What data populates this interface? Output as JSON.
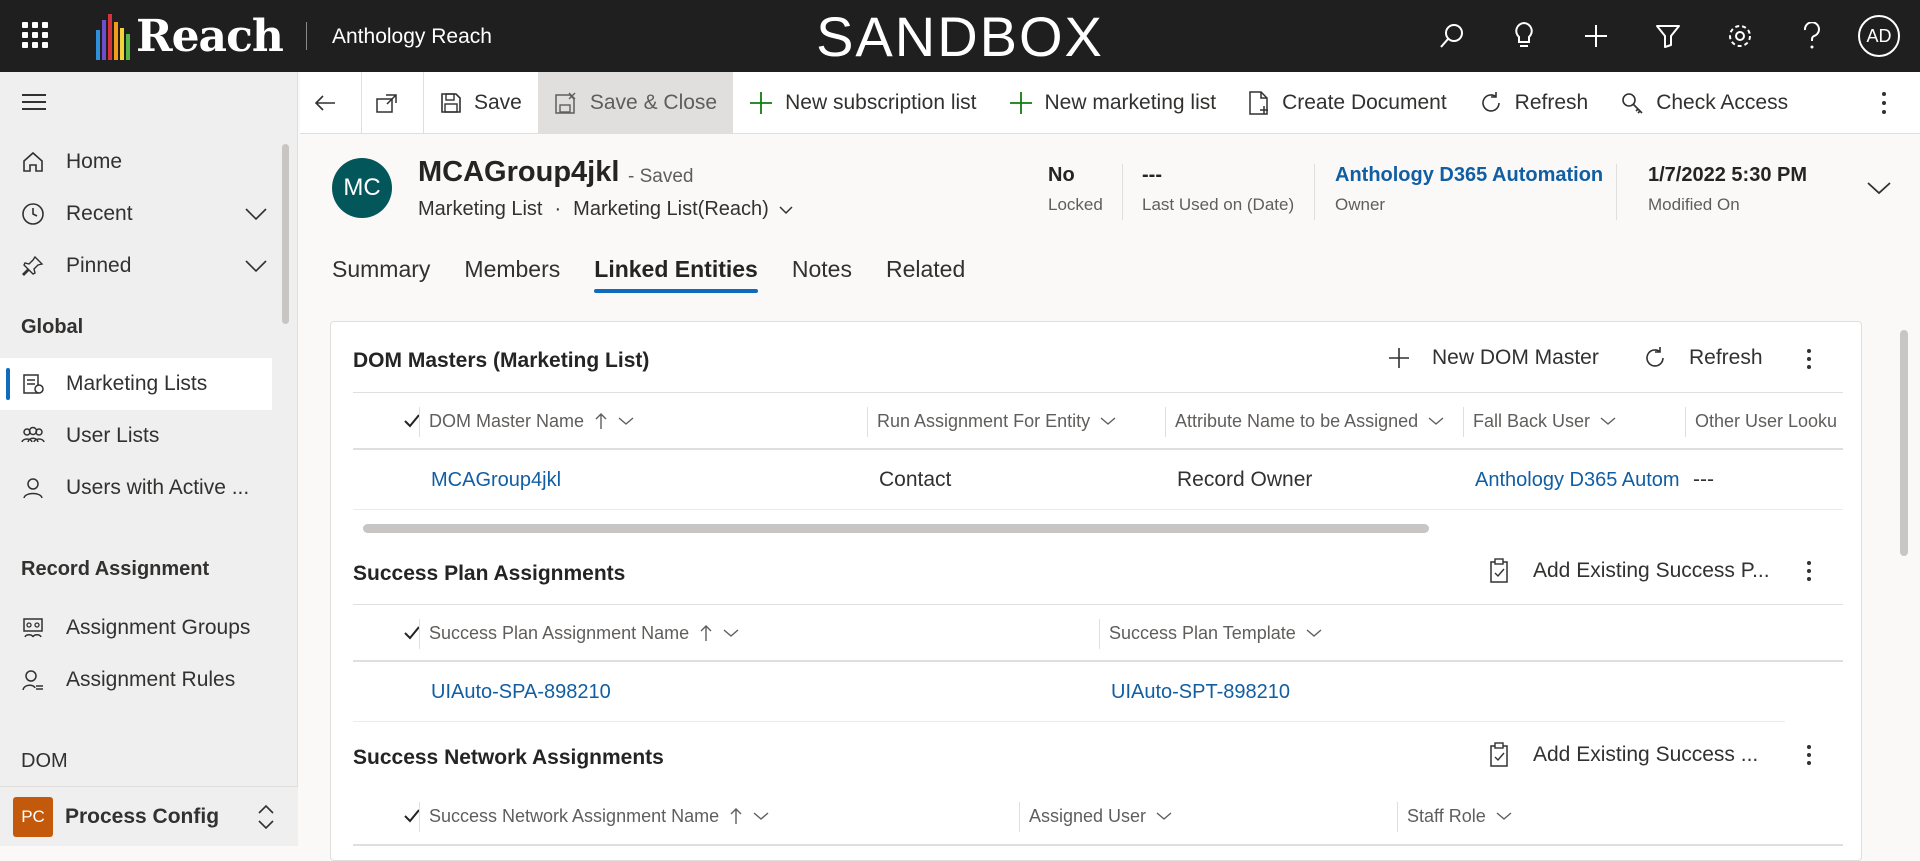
{
  "topbar": {
    "logo_text": "Reach",
    "app_name": "Anthology Reach",
    "environment": "SANDBOX",
    "user_initials": "AD",
    "icons": [
      "search-icon",
      "lightbulb-icon",
      "plus-icon",
      "filter-icon",
      "gear-icon",
      "help-icon"
    ]
  },
  "sidebar": {
    "items": [
      {
        "label": "Home"
      },
      {
        "label": "Recent"
      },
      {
        "label": "Pinned"
      }
    ],
    "group_global": "Global",
    "global_items": [
      {
        "label": "Marketing Lists"
      },
      {
        "label": "User Lists"
      },
      {
        "label": "Users with Active ..."
      }
    ],
    "group_record_assignment": "Record Assignment",
    "assignment_items": [
      {
        "label": "Assignment Groups"
      },
      {
        "label": "Assignment Rules"
      }
    ],
    "group_dom": "DOM",
    "area": {
      "badge": "PC",
      "label": "Process Config"
    }
  },
  "commands": {
    "save": "Save",
    "save_close": "Save & Close",
    "new_subscription_list": "New subscription list",
    "new_marketing_list": "New marketing list",
    "create_document": "Create Document",
    "refresh": "Refresh",
    "check_access": "Check Access"
  },
  "record": {
    "initials": "MC",
    "title": "MCAGroup4jkl",
    "saved_status": "- Saved",
    "entity": "Marketing List",
    "dot": "·",
    "form": "Marketing List(Reach)",
    "fields": [
      {
        "value": "No",
        "label": "Locked"
      },
      {
        "value": "---",
        "label": "Last Used on (Date)"
      },
      {
        "value": "Anthology D365 Automation",
        "label": "Owner"
      },
      {
        "value": "1/7/2022 5:30 PM",
        "label": "Modified On"
      }
    ]
  },
  "tabs": [
    "Summary",
    "Members",
    "Linked Entities",
    "Notes",
    "Related"
  ],
  "active_tab": "Linked Entities",
  "dom_masters": {
    "title": "DOM Masters (Marketing List)",
    "new_label": "New DOM Master",
    "refresh_label": "Refresh",
    "columns": [
      "DOM Master Name",
      "Run Assignment For Entity",
      "Attribute Name to be Assigned",
      "Fall Back User",
      "Other User Looku"
    ],
    "rows": [
      [
        "MCAGroup4jkl",
        "Contact",
        "Record Owner",
        "Anthology D365 Autom",
        "---"
      ]
    ]
  },
  "success_plan": {
    "title": "Success Plan Assignments",
    "add_label": "Add Existing Success P...",
    "columns": [
      "Success Plan Assignment Name",
      "Success Plan Template"
    ],
    "rows": [
      [
        "UIAuto-SPA-898210",
        "UIAuto-SPT-898210"
      ]
    ]
  },
  "success_network": {
    "title": "Success Network Assignments",
    "add_label": "Add Existing Success ...",
    "columns": [
      "Success Network Assignment Name",
      "Assigned User",
      "Staff Role"
    ]
  },
  "colors": {
    "topbar": "#1f1f1f",
    "link": "#115ea3",
    "accent": "#0f6cbd",
    "record_avatar": "#03565a",
    "area_badge": "#c2590b"
  }
}
